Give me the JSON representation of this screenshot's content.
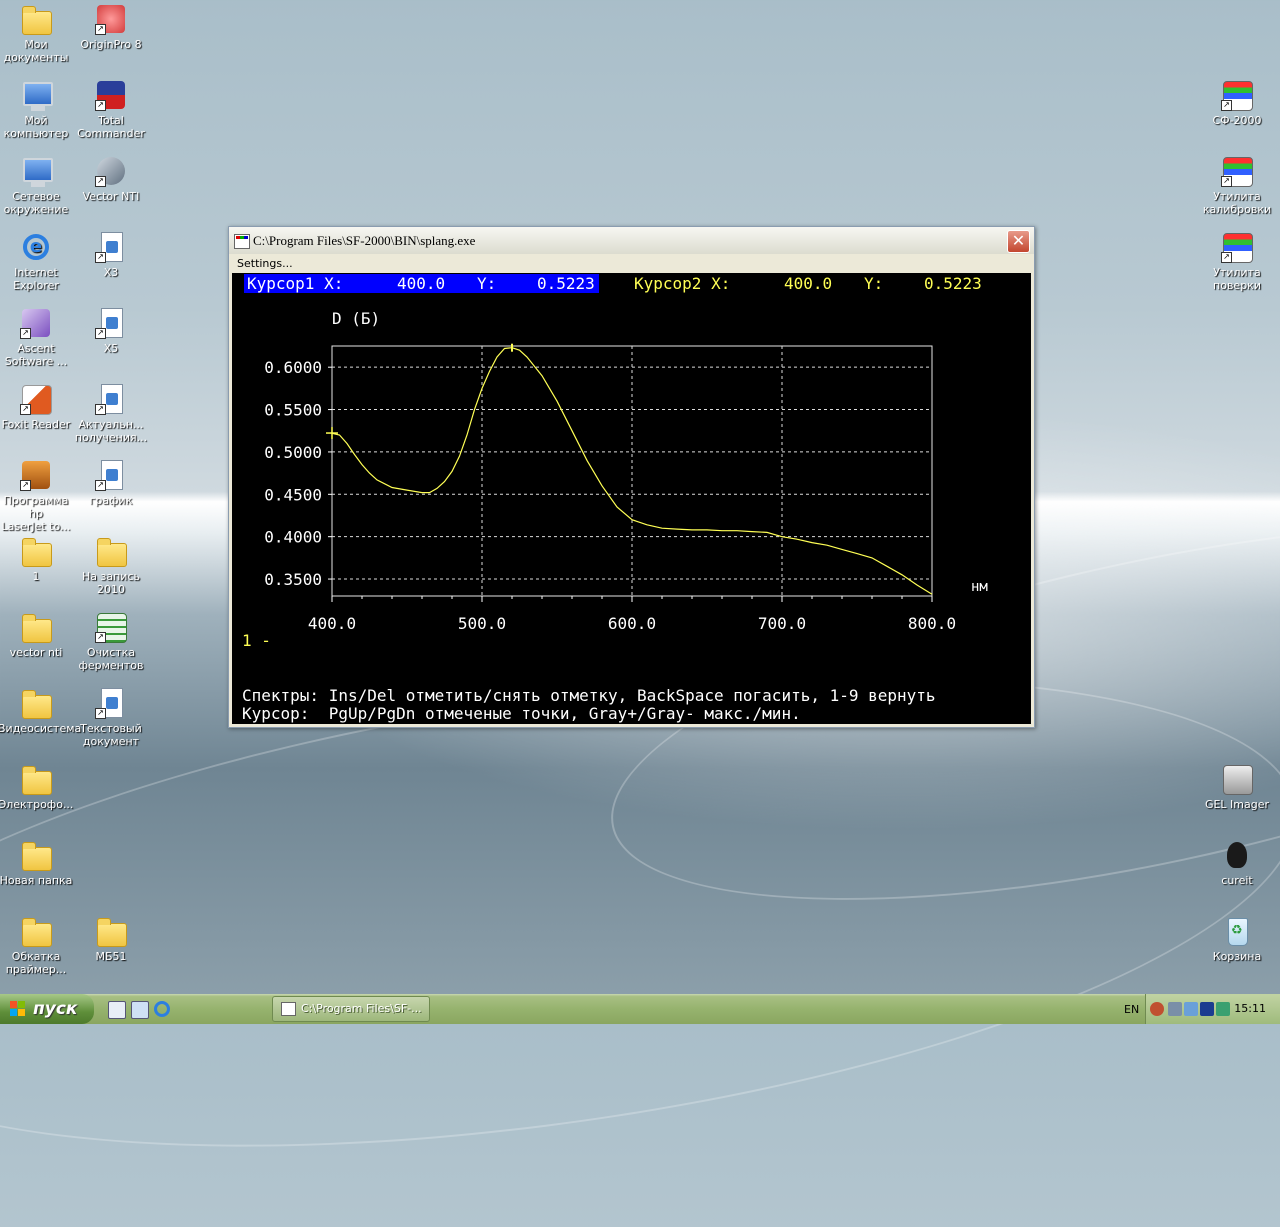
{
  "desktop": {
    "icons_left": [
      {
        "label1": "Мои",
        "label2": "документы",
        "icon": "my-documents-icon"
      },
      {
        "label1": "OriginPro 8",
        "label2": "",
        "icon": "originpro-icon"
      },
      {
        "label1": "Мой",
        "label2": "компьютер",
        "icon": "my-computer-icon"
      },
      {
        "label1": "Total",
        "label2": "Commander",
        "icon": "total-commander-icon"
      },
      {
        "label1": "Сетевое",
        "label2": "окружение",
        "icon": "network-icon"
      },
      {
        "label1": "Vector NTI",
        "label2": "",
        "icon": "vector-nti-icon"
      },
      {
        "label1": "Internet",
        "label2": "Explorer",
        "icon": "internet-explorer-icon"
      },
      {
        "label1": "X3",
        "label2": "",
        "icon": "x3-file-icon"
      },
      {
        "label1": "Ascent",
        "label2": "Software ...",
        "icon": "ascent-software-icon"
      },
      {
        "label1": "X5",
        "label2": "",
        "icon": "x5-file-icon"
      },
      {
        "label1": "Foxit Reader",
        "label2": "",
        "icon": "foxit-reader-icon"
      },
      {
        "label1": "Актуальн...",
        "label2": "получения...",
        "icon": "document-icon"
      },
      {
        "label1": "Программа hp",
        "label2": "LaserJet to...",
        "icon": "hp-laserjet-icon"
      },
      {
        "label1": "график",
        "label2": "",
        "icon": "chart-file-icon"
      },
      {
        "label1": "1",
        "label2": "",
        "icon": "folder-icon"
      },
      {
        "label1": "На запись",
        "label2": "2010",
        "icon": "archive-folder-icon"
      },
      {
        "label1": "vector nti",
        "label2": "",
        "icon": "folder-icon"
      },
      {
        "label1": "Очистка",
        "label2": "ферментов",
        "icon": "spreadsheet-icon"
      },
      {
        "label1": "Видеосистема",
        "label2": "",
        "icon": "folder-icon"
      },
      {
        "label1": "Текстовый",
        "label2": "документ",
        "icon": "text-document-icon"
      },
      {
        "label1": "Электрофо...",
        "label2": "",
        "icon": "folder-icon"
      },
      {
        "label1": "Новая папка",
        "label2": "",
        "icon": "folder-icon"
      },
      {
        "label1": "Обкатка",
        "label2": "праймер...",
        "icon": "folder-icon"
      },
      {
        "label1": "МБ51",
        "label2": "",
        "icon": "folder-icon"
      }
    ],
    "icons_right": [
      {
        "label1": "СФ-2000",
        "label2": "",
        "icon": "sf2000-icon"
      },
      {
        "label1": "Утилита",
        "label2": "калибровки",
        "icon": "calibration-utility-icon"
      },
      {
        "label1": "Утилита",
        "label2": "поверки",
        "icon": "verification-utility-icon"
      },
      {
        "label1": "GEL Imager",
        "label2": "",
        "icon": "gel-imager-icon"
      },
      {
        "label1": "cureit",
        "label2": "",
        "icon": "cureit-icon"
      },
      {
        "label1": "Корзина",
        "label2": "",
        "icon": "recycle-bin-icon"
      }
    ]
  },
  "window": {
    "title": "C:\\Program Files\\SF-2000\\BIN\\splang.exe",
    "menu_settings": "Settings...",
    "cursor1_label": "Курсор1 X:",
    "cursor1_x": "400.0",
    "cursor1_y_label": "Y:",
    "cursor1_y": "0.5223",
    "cursor2_label": "Курсор2 X:",
    "cursor2_x": "400.0",
    "cursor2_y_label": "Y:",
    "cursor2_y": "0.5223",
    "legend": "1 -",
    "help_line1": "Спектры: Ins/Del отметить/снять отметку, BackSpace погасить, 1-9 вернуть",
    "help_line2": "Курсор:  PgUp/PgDn отмеченые точки, Gray+/Gray- макс./мин.",
    "colors": {
      "trace": "#ffff55",
      "cursor_bg": "#0000ff",
      "text": "#ffffff",
      "label_yellow": "#ffff55"
    }
  },
  "chart_data": {
    "type": "line",
    "ylabel": "D (Б)",
    "xlabel": "нм",
    "xlim": [
      400,
      800
    ],
    "ylim": [
      0.33,
      0.625
    ],
    "x_ticks": [
      "400.0",
      "500.0",
      "600.0",
      "700.0",
      "800.0"
    ],
    "y_ticks": [
      "0.6000",
      "0.5500",
      "0.5000",
      "0.4500",
      "0.4000",
      "0.3500"
    ],
    "y_tick_values": [
      0.6,
      0.55,
      0.5,
      0.45,
      0.4,
      0.35
    ],
    "grid": true,
    "series": [
      {
        "x": [
          400,
          405,
          410,
          415,
          420,
          425,
          430,
          440,
          450,
          460,
          465,
          470,
          475,
          480,
          485,
          490,
          495,
          500,
          505,
          510,
          515,
          520,
          525,
          530,
          540,
          550,
          560,
          570,
          580,
          590,
          600,
          610,
          620,
          630,
          640,
          650,
          660,
          670,
          680,
          690,
          700,
          710,
          720,
          730,
          740,
          750,
          760,
          770,
          780,
          790,
          800
        ],
        "y": [
          0.522,
          0.52,
          0.51,
          0.497,
          0.485,
          0.475,
          0.467,
          0.458,
          0.455,
          0.452,
          0.452,
          0.457,
          0.465,
          0.477,
          0.495,
          0.52,
          0.55,
          0.575,
          0.595,
          0.612,
          0.622,
          0.623,
          0.62,
          0.612,
          0.59,
          0.56,
          0.525,
          0.49,
          0.46,
          0.435,
          0.42,
          0.414,
          0.41,
          0.409,
          0.408,
          0.408,
          0.407,
          0.407,
          0.406,
          0.405,
          0.4,
          0.397,
          0.393,
          0.39,
          0.385,
          0.38,
          0.375,
          0.365,
          0.355,
          0.343,
          0.332
        ]
      }
    ]
  },
  "taskbar": {
    "start_label": "пуск",
    "task_label": "C:\\Program Files\\SF-...",
    "lang": "EN",
    "clock": "15:11"
  }
}
